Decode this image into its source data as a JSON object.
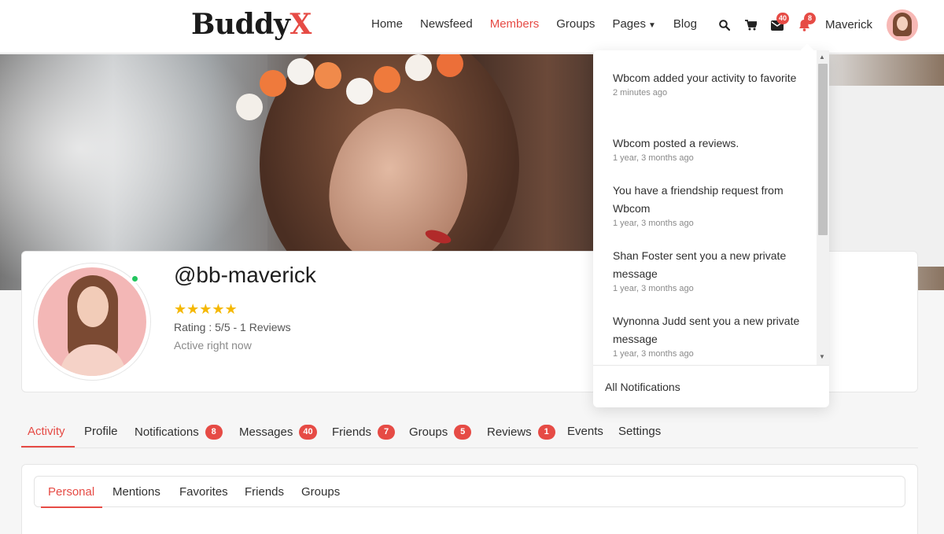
{
  "brand": {
    "logo_main": "Buddy",
    "logo_accent": "X"
  },
  "nav": [
    {
      "label": "Home"
    },
    {
      "label": "Newsfeed"
    },
    {
      "label": "Members"
    },
    {
      "label": "Groups"
    },
    {
      "label": "Pages"
    },
    {
      "label": "Blog"
    }
  ],
  "header_icons": {
    "messages_count": "40",
    "notifications_count": "8"
  },
  "user": {
    "name": "Maverick"
  },
  "profile": {
    "handle": "@bb-maverick",
    "stars": "★★★★★",
    "rating": "Rating : 5/5 - 1 Reviews",
    "status": "Active right now"
  },
  "notifications": [
    {
      "text": "Wbcom added your activity to favorite",
      "time": "2 minutes ago"
    },
    {
      "text": "Wbcom posted a reviews.",
      "time": "1 year, 3 months ago"
    },
    {
      "text": "You have a friendship request from Wbcom",
      "time": "1 year, 3 months ago"
    },
    {
      "text": "Shan Foster sent you a new private message",
      "time": "1 year, 3 months ago"
    },
    {
      "text": "Wynonna Judd sent you a new private message",
      "time": "1 year, 3 months ago"
    }
  ],
  "notifications_footer": "All Notifications",
  "tabs": [
    {
      "label": "Activity",
      "count": ""
    },
    {
      "label": "Profile",
      "count": ""
    },
    {
      "label": "Notifications",
      "count": "8"
    },
    {
      "label": "Messages",
      "count": "40"
    },
    {
      "label": "Friends",
      "count": "7"
    },
    {
      "label": "Groups",
      "count": "5"
    },
    {
      "label": "Reviews",
      "count": "1"
    },
    {
      "label": "Events",
      "count": ""
    },
    {
      "label": "Settings",
      "count": ""
    }
  ],
  "subtabs": [
    {
      "label": "Personal"
    },
    {
      "label": "Mentions"
    },
    {
      "label": "Favorites"
    },
    {
      "label": "Friends"
    },
    {
      "label": "Groups"
    }
  ],
  "colors": {
    "accent": "#e64b45",
    "star": "#f5b800",
    "online": "#22c55e"
  }
}
